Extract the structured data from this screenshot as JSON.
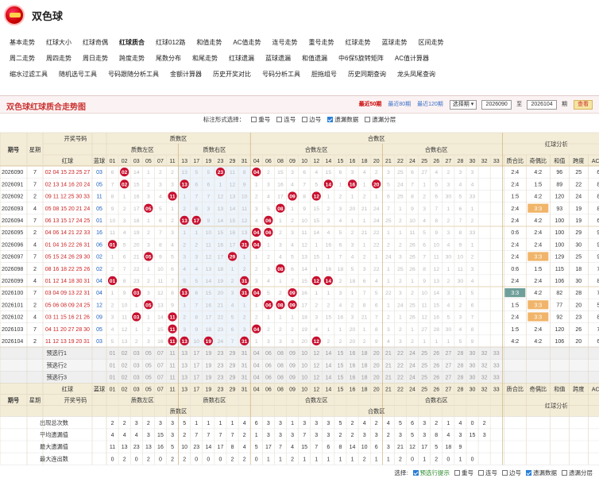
{
  "app": {
    "title": "双色球"
  },
  "nav": [
    [
      "基本走势",
      "红球大小",
      "红球奇偶",
      "红球质合",
      "红球012路",
      "和值走势",
      "AC值走势",
      "连号走势",
      "重号走势",
      "红球走势",
      "蓝球走势",
      "区间走势"
    ],
    [
      "周二走势",
      "周四走势",
      "周日走势",
      "跨度走势",
      "尾数分布",
      "和尾走势",
      "红球遗漏",
      "蓝球遗漏",
      "和值遗漏",
      "中6保5旋转矩阵",
      "AC值计算器"
    ],
    [
      "缩水过滤工具",
      "随机选号工具",
      "号码跟随分析工具",
      "金额计算器",
      "历史开奖对比",
      "号码分析工具",
      "胆拖组号",
      "历史同期查询",
      "龙头凤尾查询"
    ]
  ],
  "nav_active": "红球质合",
  "panel": {
    "title": "双色球红球质合走势图",
    "range_links": [
      "最近50期",
      "最近80期",
      "最近120期"
    ],
    "range_active": "最近50期",
    "select_label": "选择期",
    "from_issue": "2026090",
    "to_word": "至",
    "to_issue": "2026104",
    "issue_unit": "期",
    "query_button": "查看"
  },
  "options": {
    "label": "标注形式选择：",
    "items": [
      {
        "text": "重号",
        "checked": false
      },
      {
        "text": "连号",
        "checked": false
      },
      {
        "text": "边号",
        "checked": false
      },
      {
        "text": "遗漏数据",
        "checked": true
      },
      {
        "text": "遗漏分层",
        "checked": false
      }
    ]
  },
  "footer": {
    "label": "选择:",
    "items": [
      {
        "text": "预选行提示",
        "checked": true,
        "green": true
      },
      {
        "text": "重号",
        "checked": false
      },
      {
        "text": "连号",
        "checked": false
      },
      {
        "text": "边号",
        "checked": false
      },
      {
        "text": "遗漏数据",
        "checked": true
      },
      {
        "text": "遗漏分层",
        "checked": false
      }
    ]
  },
  "table": {
    "h_issue": "期号",
    "h_week": "星期",
    "h_numbers": "开奖号码",
    "h_red": "红球",
    "h_blue": "蓝球",
    "zones": [
      "质数区",
      "合数区"
    ],
    "subzones": [
      "质数左区",
      "质数右区",
      "合数左区",
      "合数右区"
    ],
    "analysis": "红球分析",
    "ana_cols": [
      "质合比",
      "奇偶比",
      "和值",
      "跨度",
      "AC值"
    ],
    "prime_nums": [
      "01",
      "02",
      "03",
      "05",
      "07",
      "11",
      "13",
      "17",
      "19",
      "23",
      "29",
      "31"
    ],
    "comp_nums": [
      "04",
      "06",
      "08",
      "09",
      "10",
      "12",
      "14",
      "15",
      "16",
      "18",
      "20",
      "21",
      "22",
      "24",
      "25",
      "26",
      "27",
      "28",
      "30",
      "32",
      "33"
    ],
    "rows": [
      {
        "issue": "2026090",
        "week": "7",
        "red": "02 04 15 23 25 27",
        "blue": "03",
        "cells": [
          "6",
          "02",
          "14",
          "1",
          "2",
          "2",
          "13",
          "5",
          "5",
          "23",
          "11",
          "8",
          "04",
          "2",
          "15",
          "3",
          "6",
          "4",
          "15",
          "6",
          "3",
          "4",
          "2",
          "3",
          "25",
          "6",
          "27",
          "4",
          "2",
          "3",
          "3"
        ],
        "ana": [
          "2:4",
          "4:2",
          "96",
          "25",
          "6"
        ]
      },
      {
        "issue": "2026091",
        "week": "7",
        "red": "02 13 14 16 20 24",
        "blue": "05",
        "cells": [
          "7",
          "02",
          "15",
          "2",
          "3",
          "3",
          "13",
          "6",
          "6",
          "1",
          "12",
          "9",
          "1",
          "3",
          "16",
          "4",
          "7",
          "5",
          "14",
          "1",
          "16",
          "1",
          "20",
          "5",
          "24",
          "7",
          "1",
          "5",
          "3",
          "4",
          "4"
        ],
        "ana": [
          "2:4",
          "1:5",
          "89",
          "22",
          "8"
        ]
      },
      {
        "issue": "2026092",
        "week": "2",
        "red": "09 11 12 25 30 33",
        "blue": "11",
        "cells": [
          "8",
          "1",
          "16",
          "3",
          "4",
          "11",
          "1",
          "7",
          "7",
          "12",
          "13",
          "10",
          "2",
          "4",
          "17",
          "09",
          "8",
          "12",
          "1",
          "2",
          "1",
          "2",
          "1",
          "6",
          "25",
          "8",
          "2",
          "6",
          "30",
          "5",
          "33"
        ],
        "ana": [
          "1:5",
          "4:2",
          "120",
          "24",
          "8"
        ]
      },
      {
        "issue": "2026093",
        "week": "4",
        "red": "05 08 15 20 21 24",
        "blue": "05",
        "cells": [
          "9",
          "2",
          "17",
          "05",
          "5",
          "1",
          "2",
          "8",
          "3",
          "13",
          "14",
          "11",
          "3",
          "5",
          "08",
          "1",
          "9",
          "15",
          "2",
          "3",
          "20",
          "21",
          "24",
          "7",
          "1",
          "9",
          "3",
          "7",
          "1",
          "6",
          "1"
        ],
        "ana": [
          "2:4",
          "3:3",
          "93",
          "19",
          "8"
        ]
      },
      {
        "issue": "2026094",
        "week": "7",
        "red": "06 13 15 17 24 25",
        "blue": "01",
        "cells": [
          "10",
          "3",
          "18",
          "1",
          "6",
          "2",
          "13",
          "17",
          "9",
          "14",
          "15",
          "12",
          "4",
          "06",
          "1",
          "2",
          "10",
          "15",
          "3",
          "4",
          "1",
          "1",
          "24",
          "25",
          "2",
          "10",
          "4",
          "8",
          "2",
          "7",
          "2"
        ],
        "ana": [
          "2:4",
          "4:2",
          "100",
          "19",
          "6"
        ]
      },
      {
        "issue": "2026095",
        "week": "2",
        "red": "04 06 14 21 22 33",
        "blue": "16",
        "cells": [
          "11",
          "4",
          "19",
          "2",
          "7",
          "3",
          "1",
          "1",
          "10",
          "15",
          "16",
          "13",
          "04",
          "06",
          "2",
          "3",
          "11",
          "14",
          "4",
          "5",
          "2",
          "21",
          "22",
          "1",
          "1",
          "11",
          "5",
          "9",
          "3",
          "8",
          "33"
        ],
        "ana": [
          "0:6",
          "2:4",
          "100",
          "29",
          "9"
        ]
      },
      {
        "issue": "2026096",
        "week": "4",
        "red": "01 04 16 22 26 31",
        "blue": "06",
        "cells": [
          "01",
          "5",
          "20",
          "3",
          "8",
          "4",
          "2",
          "2",
          "11",
          "16",
          "17",
          "31",
          "04",
          "1",
          "3",
          "4",
          "12",
          "1",
          "16",
          "6",
          "3",
          "1",
          "22",
          "2",
          "2",
          "26",
          "6",
          "10",
          "4",
          "9",
          "1"
        ],
        "ana": [
          "2:4",
          "2:4",
          "100",
          "30",
          "9"
        ]
      },
      {
        "issue": "2026097",
        "week": "7",
        "red": "05 15 24 26 29 30",
        "blue": "02",
        "cells": [
          "1",
          "6",
          "21",
          "05",
          "9",
          "5",
          "3",
          "3",
          "12",
          "17",
          "29",
          "1",
          "1",
          "2",
          "4",
          "5",
          "13",
          "15",
          "1",
          "7",
          "4",
          "2",
          "1",
          "24",
          "3",
          "26",
          "7",
          "11",
          "30",
          "10",
          "2"
        ],
        "ana": [
          "2:4",
          "3:3",
          "129",
          "25",
          "9"
        ]
      },
      {
        "issue": "2026098",
        "week": "2",
        "red": "08 16 18 22 25 26",
        "blue": "02",
        "cells": [
          "2",
          "7",
          "22",
          "1",
          "10",
          "6",
          "4",
          "4",
          "13",
          "18",
          "1",
          "2",
          "2",
          "3",
          "08",
          "6",
          "14",
          "1",
          "16",
          "18",
          "5",
          "3",
          "22",
          "1",
          "25",
          "26",
          "8",
          "12",
          "1",
          "11",
          "3"
        ],
        "ana": [
          "0:6",
          "1:5",
          "115",
          "18",
          "7"
        ]
      },
      {
        "issue": "2026099",
        "week": "4",
        "red": "01 12 14 18 30 31",
        "blue": "04",
        "cells": [
          "01",
          "8",
          "23",
          "2",
          "11",
          "7",
          "5",
          "5",
          "14",
          "19",
          "2",
          "31",
          "3",
          "4",
          "1",
          "7",
          "15",
          "12",
          "14",
          "2",
          "18",
          "6",
          "4",
          "1",
          "2",
          "1",
          "9",
          "13",
          "2",
          "30",
          "4"
        ],
        "ana": [
          "2:4",
          "2:4",
          "106",
          "30",
          "8"
        ]
      },
      {
        "issue": "2026100",
        "week": "7",
        "red": "03 04 09 13 22 31",
        "blue": "04",
        "cells": [
          "1",
          "9",
          "03",
          "3",
          "12",
          "8",
          "13",
          "6",
          "15",
          "20",
          "3",
          "31",
          "04",
          "5",
          "2",
          "09",
          "16",
          "1",
          "1",
          "3",
          "1",
          "7",
          "5",
          "22",
          "3",
          "2",
          "10",
          "14",
          "3",
          "1",
          "5"
        ],
        "ana": [
          "3:3",
          "4:2",
          "82",
          "28",
          "7"
        ]
      },
      {
        "issue": "2026101",
        "week": "2",
        "red": "05 06 08 09 24 25",
        "blue": "12",
        "cells": [
          "2",
          "10",
          "1",
          "05",
          "13",
          "9",
          "1",
          "7",
          "16",
          "21",
          "4",
          "1",
          "1",
          "06",
          "08",
          "09",
          "17",
          "2",
          "2",
          "4",
          "2",
          "8",
          "6",
          "1",
          "24",
          "25",
          "11",
          "15",
          "4",
          "2",
          "6"
        ],
        "ana": [
          "1:5",
          "3:3",
          "77",
          "20",
          "5"
        ]
      },
      {
        "issue": "2026102",
        "week": "4",
        "red": "03 11 15 16 21 26",
        "blue": "09",
        "cells": [
          "3",
          "11",
          "03",
          "1",
          "14",
          "11",
          "2",
          "8",
          "17",
          "22",
          "5",
          "2",
          "2",
          "1",
          "1",
          "1",
          "18",
          "3",
          "15",
          "16",
          "3",
          "21",
          "7",
          "2",
          "1",
          "26",
          "12",
          "16",
          "5",
          "3",
          "7"
        ],
        "ana": [
          "2:4",
          "3:3",
          "92",
          "23",
          "8"
        ]
      },
      {
        "issue": "2026103",
        "week": "7",
        "red": "04 11 20 27 28 30",
        "blue": "05",
        "cells": [
          "4",
          "12",
          "1",
          "2",
          "15",
          "11",
          "3",
          "9",
          "18",
          "23",
          "6",
          "3",
          "04",
          "2",
          "2",
          "2",
          "19",
          "4",
          "1",
          "1",
          "20",
          "1",
          "8",
          "3",
          "2",
          "1",
          "27",
          "28",
          "30",
          "4",
          "8"
        ],
        "ana": [
          "1:5",
          "2:4",
          "120",
          "26",
          "7"
        ]
      },
      {
        "issue": "2026104",
        "week": "2",
        "red": "11 12 13 19 20 31",
        "blue": "03",
        "cells": [
          "5",
          "13",
          "2",
          "3",
          "16",
          "11",
          "13",
          "10",
          "19",
          "24",
          "7",
          "31",
          "1",
          "3",
          "3",
          "3",
          "20",
          "12",
          "2",
          "2",
          "20",
          "2",
          "9",
          "4",
          "3",
          "2",
          "1",
          "1",
          "1",
          "5",
          "9"
        ],
        "ana": [
          "4:2",
          "4:2",
          "106",
          "20",
          "6"
        ]
      }
    ],
    "preselect": [
      "预选行1",
      "预选行2",
      "预选行3"
    ],
    "stats": [
      {
        "label": "出现总次数",
        "values": [
          "2",
          "2",
          "3",
          "2",
          "3",
          "3",
          "5",
          "1",
          "1",
          "1",
          "1",
          "4",
          "6",
          "3",
          "3",
          "1",
          "3",
          "3",
          "3",
          "5",
          "2",
          "4",
          "2",
          "4",
          "5",
          "6",
          "3",
          "2",
          "1",
          "4",
          "0",
          "2"
        ]
      },
      {
        "label": "平均遗漏值",
        "values": [
          "4",
          "4",
          "4",
          "3",
          "15",
          "3",
          "2",
          "7",
          "7",
          "7",
          "7",
          "2",
          "1",
          "3",
          "3",
          "3",
          "7",
          "3",
          "3",
          "2",
          "2",
          "3",
          "3",
          "2",
          "3",
          "5",
          "3",
          "8",
          "4",
          "3",
          "15",
          "3"
        ]
      },
      {
        "label": "最大遗漏值",
        "values": [
          "11",
          "13",
          "23",
          "13",
          "16",
          "5",
          "10",
          "23",
          "14",
          "17",
          "8",
          "4",
          "5",
          "17",
          "7",
          "4",
          "15",
          "7",
          "6",
          "8",
          "14",
          "10",
          "6",
          "3",
          "21",
          "12",
          "17",
          "5",
          "18",
          "9"
        ]
      },
      {
        "label": "最大连出数",
        "values": [
          "0",
          "2",
          "0",
          "2",
          "0",
          "2",
          "2",
          "0",
          "0",
          "0",
          "2",
          "2",
          "0",
          "1",
          "1",
          "2",
          "1",
          "1",
          "1",
          "1",
          "1",
          "2",
          "1",
          "1",
          "2",
          "0",
          "1",
          "2",
          "0",
          "1",
          "0"
        ]
      }
    ]
  }
}
